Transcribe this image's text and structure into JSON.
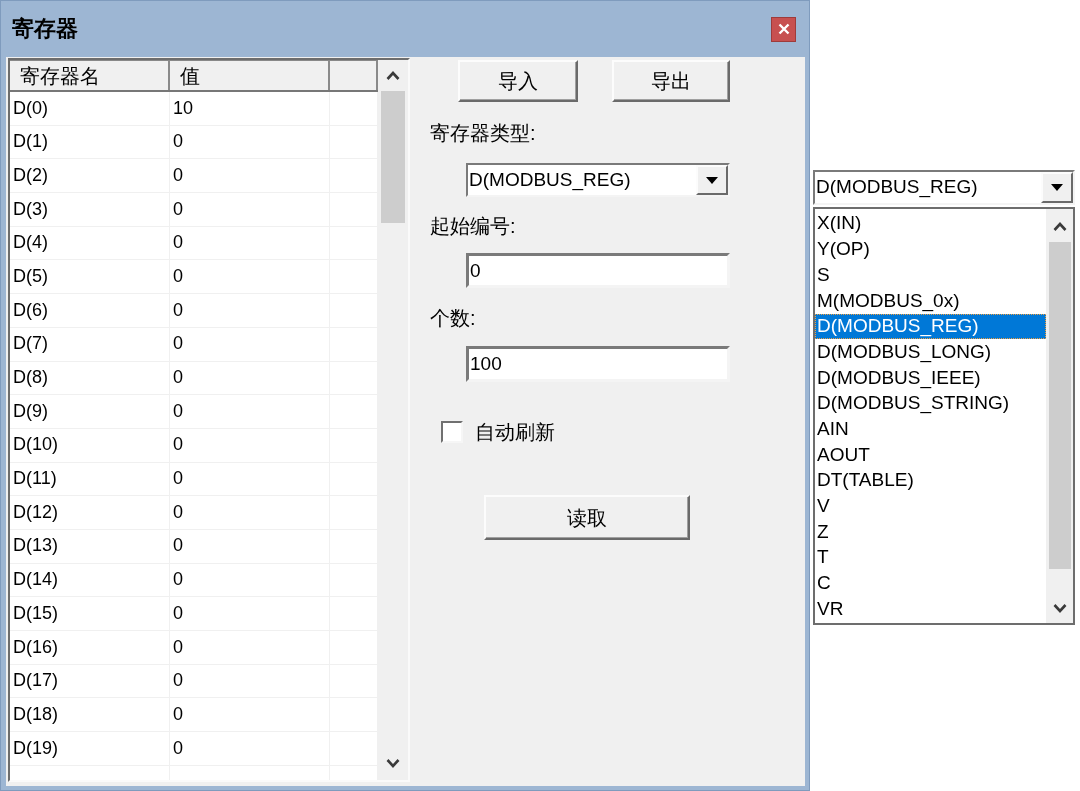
{
  "window": {
    "title": "寄存器"
  },
  "register_table": {
    "columns": [
      "寄存器名",
      "值"
    ],
    "rows": [
      {
        "name": "D(0)",
        "value": "10"
      },
      {
        "name": "D(1)",
        "value": "0"
      },
      {
        "name": "D(2)",
        "value": "0"
      },
      {
        "name": "D(3)",
        "value": "0"
      },
      {
        "name": "D(4)",
        "value": "0"
      },
      {
        "name": "D(5)",
        "value": "0"
      },
      {
        "name": "D(6)",
        "value": "0"
      },
      {
        "name": "D(7)",
        "value": "0"
      },
      {
        "name": "D(8)",
        "value": "0"
      },
      {
        "name": "D(9)",
        "value": "0"
      },
      {
        "name": "D(10)",
        "value": "0"
      },
      {
        "name": "D(11)",
        "value": "0"
      },
      {
        "name": "D(12)",
        "value": "0"
      },
      {
        "name": "D(13)",
        "value": "0"
      },
      {
        "name": "D(14)",
        "value": "0"
      },
      {
        "name": "D(15)",
        "value": "0"
      },
      {
        "name": "D(16)",
        "value": "0"
      },
      {
        "name": "D(17)",
        "value": "0"
      },
      {
        "name": "D(18)",
        "value": "0"
      },
      {
        "name": "D(19)",
        "value": "0"
      }
    ]
  },
  "buttons": [
    "导入",
    "导出"
  ],
  "register_type": {
    "label": "寄存器类型:",
    "value": "D(MODBUS_REG)"
  },
  "start_number": {
    "label": "起始编号:",
    "value": "0"
  },
  "count": {
    "label": "个数:",
    "value": "100"
  },
  "auto_refresh": {
    "label": "自动刷新",
    "checked": false
  },
  "read_button": "读取",
  "type_dropdown": {
    "value": "D(MODBUS_REG)",
    "options": [
      {
        "label": "X(IN)",
        "selected": false
      },
      {
        "label": "Y(OP)",
        "selected": false
      },
      {
        "label": "S",
        "selected": false
      },
      {
        "label": "M(MODBUS_0x)",
        "selected": false
      },
      {
        "label": "D(MODBUS_REG)",
        "selected": true
      },
      {
        "label": "D(MODBUS_LONG)",
        "selected": false
      },
      {
        "label": "D(MODBUS_IEEE)",
        "selected": false
      },
      {
        "label": "D(MODBUS_STRING)",
        "selected": false
      },
      {
        "label": "AIN",
        "selected": false
      },
      {
        "label": "AOUT",
        "selected": false
      },
      {
        "label": "DT(TABLE)",
        "selected": false
      },
      {
        "label": "V",
        "selected": false
      },
      {
        "label": "Z",
        "selected": false
      },
      {
        "label": "T",
        "selected": false
      },
      {
        "label": "C",
        "selected": false
      },
      {
        "label": "VR",
        "selected": false
      }
    ]
  }
}
